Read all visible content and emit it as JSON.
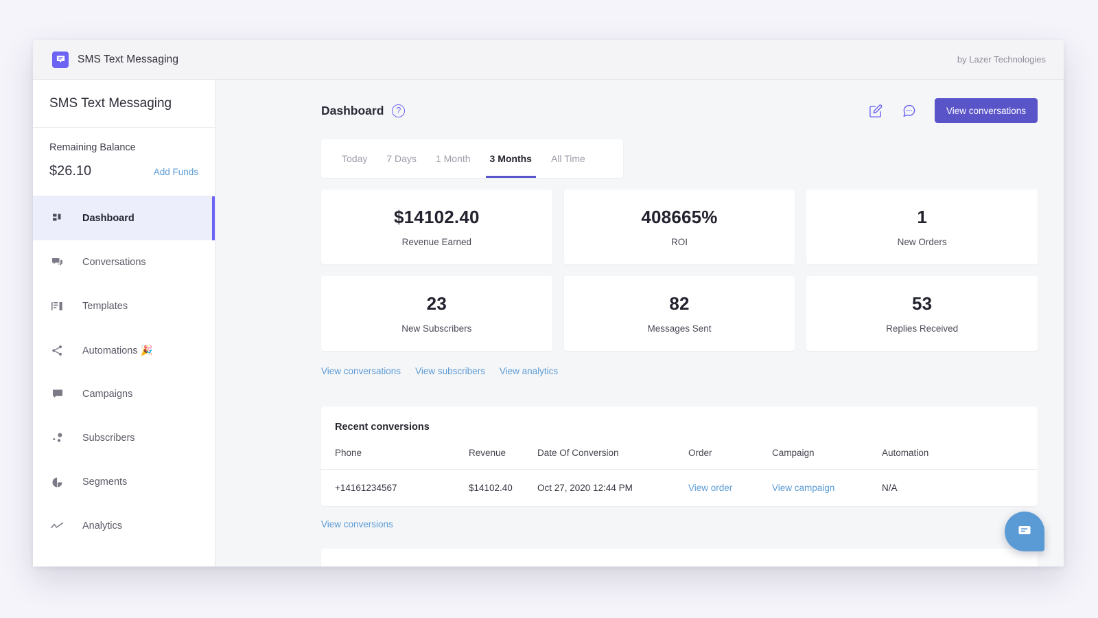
{
  "window": {
    "topbar": {
      "app_icon": "speech-bubble-icon",
      "title": "SMS Text Messaging",
      "credit": "by Lazer Technologies"
    }
  },
  "sidebar": {
    "brand": "SMS Text Messaging",
    "balance": {
      "label": "Remaining Balance",
      "amount": "$26.10",
      "action_label": "Add Funds"
    },
    "items": [
      {
        "label": "Dashboard",
        "icon": "grid-icon",
        "active": true
      },
      {
        "label": "Conversations",
        "icon": "chat-icon",
        "active": false
      },
      {
        "label": "Templates",
        "icon": "list-icon",
        "active": false
      },
      {
        "label": "Automations 🎉",
        "icon": "share-icon",
        "active": false
      },
      {
        "label": "Campaigns",
        "icon": "message-icon",
        "active": false
      },
      {
        "label": "Subscribers",
        "icon": "nodes-icon",
        "active": false
      },
      {
        "label": "Segments",
        "icon": "pie-chart-icon",
        "active": false
      },
      {
        "label": "Analytics",
        "icon": "trend-line-icon",
        "active": false
      }
    ]
  },
  "main": {
    "page_title": "Dashboard",
    "help_glyph": "?",
    "header_icons": [
      {
        "name": "compose-icon"
      },
      {
        "name": "chat-bubble-icon"
      }
    ],
    "primary_button": "View conversations",
    "tabs": [
      {
        "label": "Today",
        "active": false
      },
      {
        "label": "7 Days",
        "active": false
      },
      {
        "label": "1 Month",
        "active": false
      },
      {
        "label": "3 Months",
        "active": true
      },
      {
        "label": "All Time",
        "active": false
      }
    ],
    "stats": [
      {
        "value": "$14102.40",
        "label": "Revenue Earned"
      },
      {
        "value": "408665%",
        "label": "ROI"
      },
      {
        "value": "1",
        "label": "New Orders"
      },
      {
        "value": "23",
        "label": "New Subscribers"
      },
      {
        "value": "82",
        "label": "Messages Sent"
      },
      {
        "value": "53",
        "label": "Replies Received"
      }
    ],
    "quick_links": [
      "View conversations",
      "View subscribers",
      "View analytics"
    ],
    "recent_conversions": {
      "title": "Recent conversions",
      "columns": [
        "Phone",
        "Revenue",
        "Date Of Conversion",
        "Order",
        "Campaign",
        "Automation"
      ],
      "rows": [
        {
          "phone": "+14161234567",
          "revenue": "$14102.40",
          "date": "Oct 27, 2020 12:44 PM",
          "order": "View order",
          "campaign": "View campaign",
          "automation": "N/A"
        }
      ],
      "footer_link": "View conversions"
    }
  },
  "chat_widget": {
    "icon": "chat-widget-icon"
  },
  "colors": {
    "brand_purple": "#6c63f5",
    "button_purple": "#5a54c9",
    "link_blue": "#5b9bd5",
    "chat_blue": "#5b9bd5",
    "page_bg": "#f5f6f8",
    "desktop_bg": "#f5f4fb"
  }
}
